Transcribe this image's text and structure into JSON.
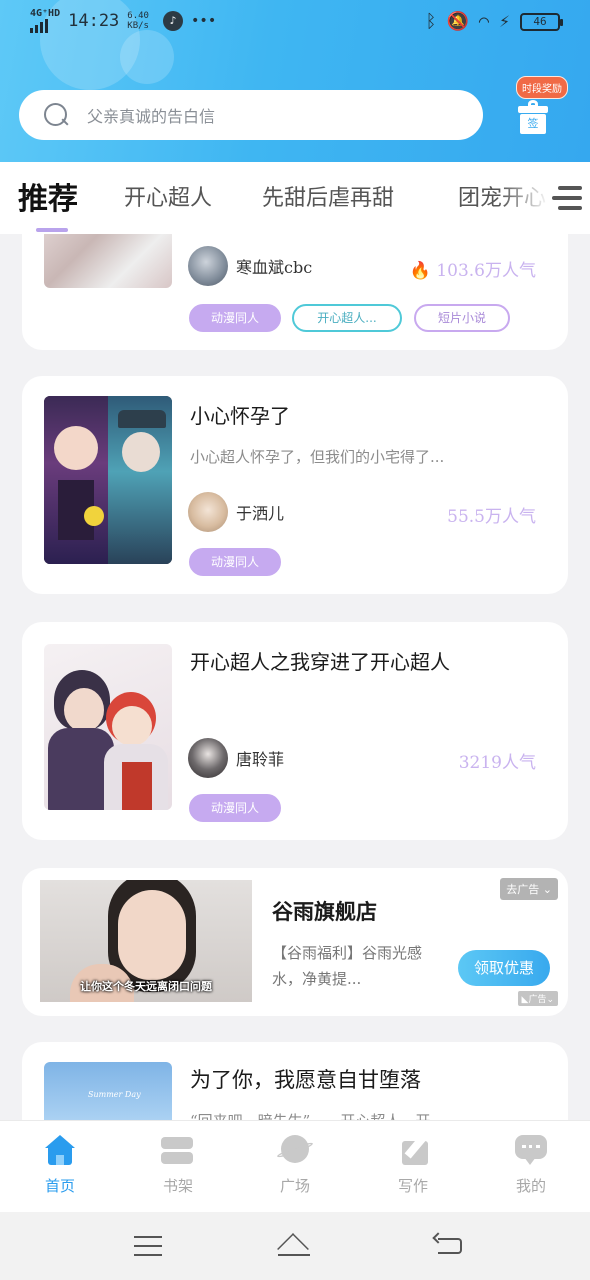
{
  "status_bar": {
    "network": "4G⁺HD",
    "time": "14:23",
    "speed_value": "6.40",
    "speed_unit": "KB/s",
    "more": "•••",
    "battery": "46"
  },
  "search": {
    "placeholder": "父亲真诚的告白信"
  },
  "signin": {
    "badge": "时段奖励",
    "label": "签"
  },
  "tabs": [
    "推荐",
    "开心超人",
    "先甜后虐再甜",
    "团宠开心"
  ],
  "cards": [
    {
      "author": "寒血斌cbc",
      "popularity": "103.6万人气",
      "tags": [
        "动漫同人",
        "开心超人...",
        "短片小说"
      ]
    },
    {
      "title": "小心怀孕了",
      "description": "小心超人怀孕了，但我们的小宅得了...",
      "author": "于洒儿",
      "popularity": "55.5万人气",
      "tags": [
        "动漫同人"
      ]
    },
    {
      "title": "开心超人之我穿进了开心超人",
      "author": "唐聆菲",
      "popularity": "3219人气",
      "tags": [
        "动漫同人"
      ]
    }
  ],
  "ad": {
    "image_caption": "让你这个冬天远离闭口问题",
    "title": "谷雨旗舰店",
    "description": "【谷雨福利】谷雨光感水，净黄提...",
    "button": "领取优惠",
    "close": "去广告",
    "mark": "广告"
  },
  "last_card": {
    "title": "为了你，我愿意自甘堕落",
    "description": "“回来吧，暗先生”——开心超人，开",
    "cover_text": "Summer Day"
  },
  "bottom_nav": [
    {
      "label": "首页",
      "icon": "home-icon"
    },
    {
      "label": "书架",
      "icon": "bookshelf-icon"
    },
    {
      "label": "广场",
      "icon": "planet-icon"
    },
    {
      "label": "写作",
      "icon": "pen-icon"
    },
    {
      "label": "我的",
      "icon": "chat-icon"
    }
  ],
  "colors": {
    "accent": "#38a9ee",
    "tag_purple": "#c6aaf0",
    "popularity": "#c9b3ef"
  }
}
